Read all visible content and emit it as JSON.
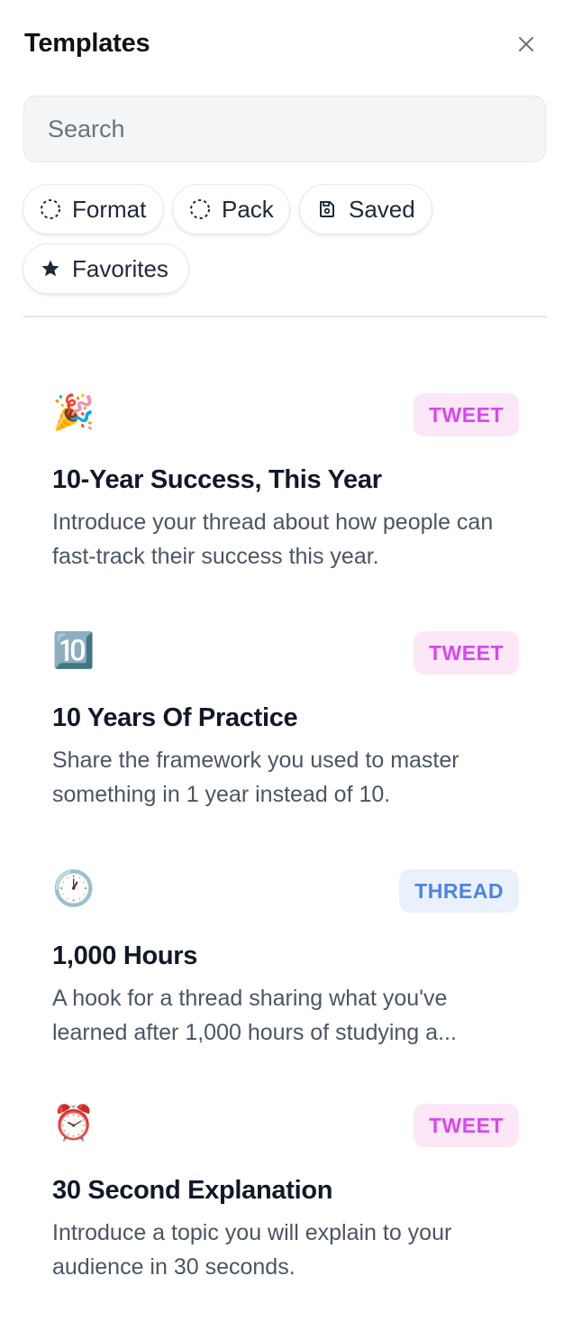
{
  "header": {
    "title": "Templates",
    "close_icon": "close-icon"
  },
  "search": {
    "placeholder": "Search",
    "value": ""
  },
  "filters": [
    {
      "label": "Format",
      "icon": "dashed-circle-icon"
    },
    {
      "label": "Pack",
      "icon": "dashed-circle-icon"
    },
    {
      "label": "Saved",
      "icon": "save-icon"
    },
    {
      "label": "Favorites",
      "icon": "star-icon"
    }
  ],
  "templates": [
    {
      "emoji": "🎉",
      "type": "TWEET",
      "title": "10-Year Success, This Year",
      "description": "Introduce your thread about how people can fast-track their success this year."
    },
    {
      "emoji": "🔟",
      "type": "TWEET",
      "title": "10 Years Of Practice",
      "description": "Share the framework you used to master something in 1 year instead of 10."
    },
    {
      "emoji": "🕐",
      "type": "THREAD",
      "title": "1,000 Hours",
      "description": "A hook for a thread sharing what you've learned after 1,000 hours of studying a..."
    },
    {
      "emoji": "⏰",
      "type": "TWEET",
      "title": "30 Second Explanation",
      "description": "Introduce a topic you will explain to your audience in 30 seconds."
    }
  ],
  "colors": {
    "tweet_badge_bg": "#fce7f6",
    "tweet_badge_text": "#d946ef",
    "thread_badge_bg": "#eaf1fd",
    "thread_badge_text": "#4a84e0"
  }
}
